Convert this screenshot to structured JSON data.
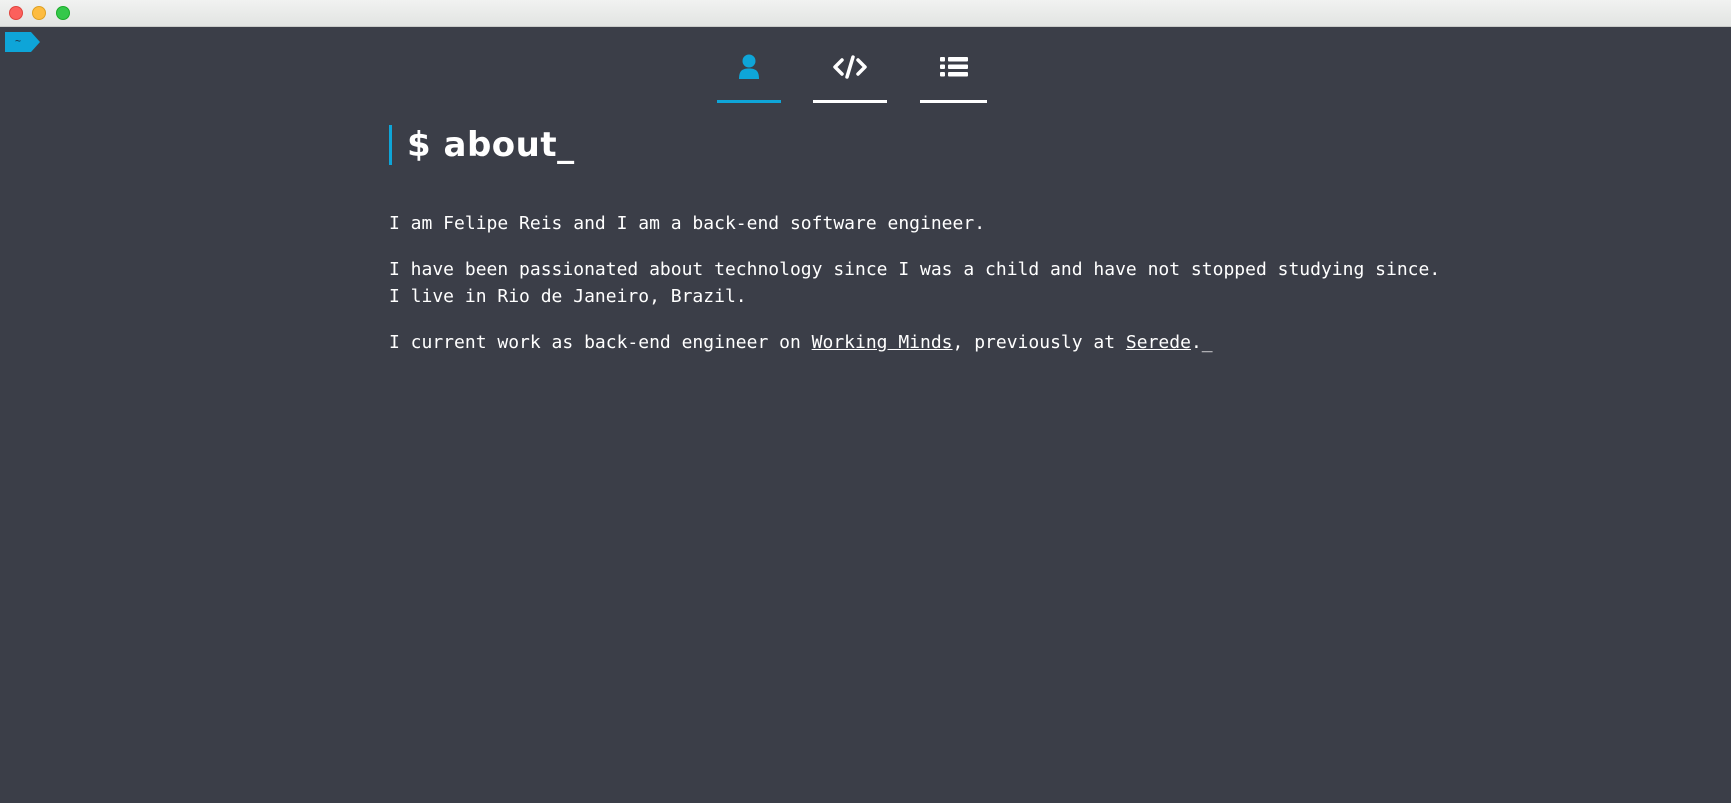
{
  "window": {
    "title": ""
  },
  "prompt_tag": {
    "label": "~"
  },
  "nav": {
    "items": [
      {
        "icon": "user-icon",
        "active": true
      },
      {
        "icon": "code-icon",
        "active": false
      },
      {
        "icon": "list-icon",
        "active": false
      }
    ],
    "accent_color": "#0ea5d8"
  },
  "page": {
    "heading": "$ about_",
    "paragraph_1": "I am Felipe Reis and I am a back-end software engineer.",
    "paragraph_2": "I have been passionated about technology since I was a child and have not stopped studying since. I live in Rio de Janeiro, Brazil.",
    "paragraph_3_prefix": "I current work as back-end engineer on ",
    "link_1": "Working Minds",
    "paragraph_3_middle": ", previously at ",
    "link_2": "Serede",
    "paragraph_3_suffix": ".",
    "cursor": "_"
  },
  "colors": {
    "background": "#3b3e48",
    "accent": "#0ea5d8",
    "text": "#ffffff"
  }
}
